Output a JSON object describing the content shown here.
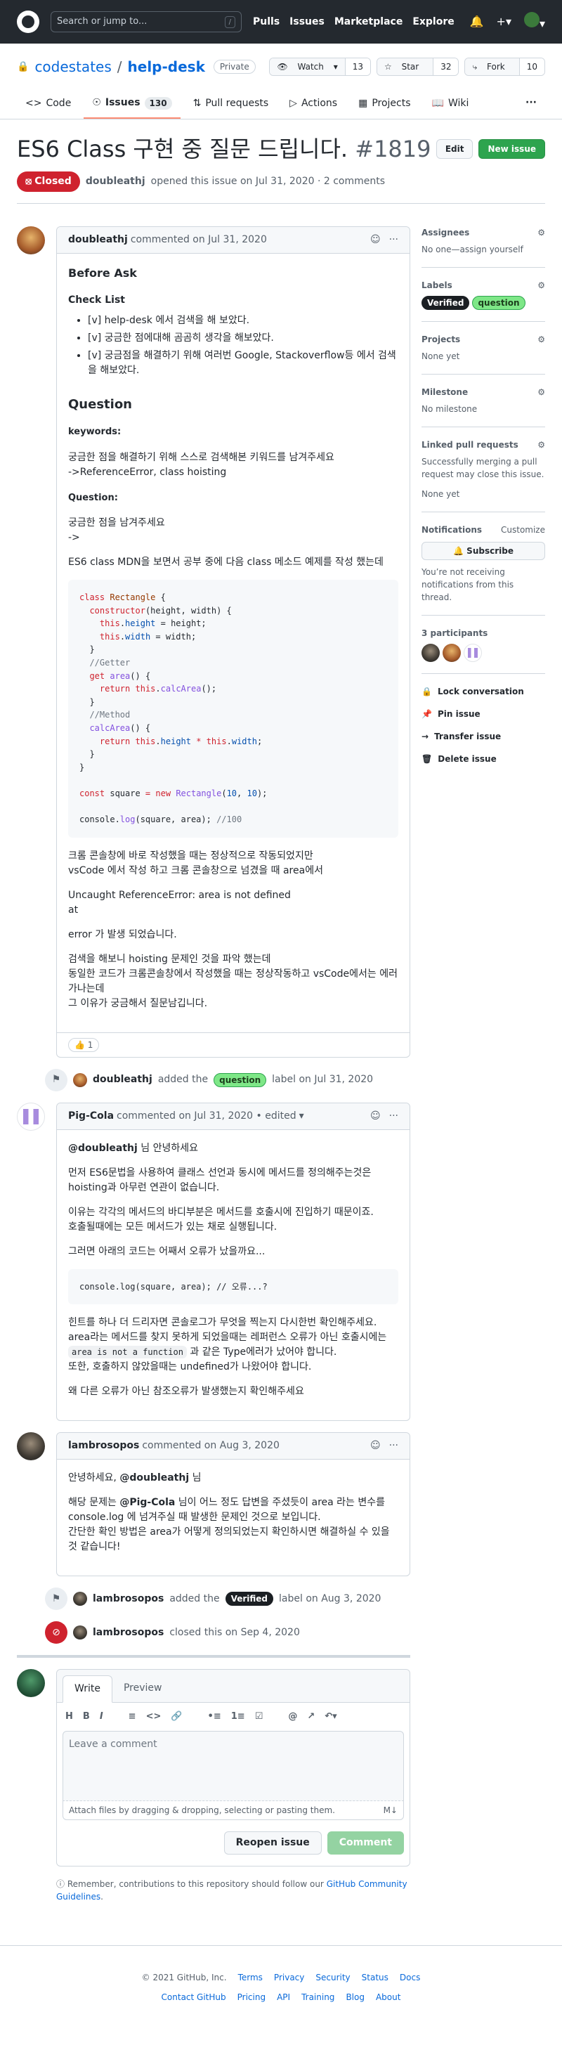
{
  "header": {
    "search_placeholder": "Search or jump to...",
    "search_shortcut": "/",
    "nav": [
      "Pulls",
      "Issues",
      "Marketplace",
      "Explore"
    ]
  },
  "repo": {
    "owner": "codestates",
    "name": "help-desk",
    "visibility": "Private",
    "watch_label": "Watch",
    "watch_count": "13",
    "star_label": "Star",
    "star_count": "32",
    "fork_label": "Fork",
    "fork_count": "10"
  },
  "tabs": [
    {
      "label": "Code"
    },
    {
      "label": "Issues",
      "count": "130"
    },
    {
      "label": "Pull requests"
    },
    {
      "label": "Actions"
    },
    {
      "label": "Projects"
    },
    {
      "label": "Wiki"
    }
  ],
  "issue": {
    "title": "ES6 Class 구현 중 질문 드립니다.",
    "number": "#1819",
    "edit_label": "Edit",
    "new_issue_label": "New issue",
    "state": "Closed",
    "author": "doubleathj",
    "meta_text": "opened this issue on Jul 31, 2020 · 2 comments"
  },
  "first_comment": {
    "author": "doubleathj",
    "date": "commented on Jul 31, 2020",
    "h_before": "Before Ask",
    "h_checklist": "Check List",
    "checklist": [
      "[v] help-desk 에서 검색을 해 보았다.",
      "[v] 궁금한 점에대해 곰곰히 생각을 해보았다.",
      "[v] 궁금점을 해결하기 위해 여러번 Google, Stackoverflow등 에서 검색을 해보았다."
    ],
    "h_question": "Question",
    "h_keywords": "keywords:",
    "keywords_line1": "궁금한 점을 해결하기 위해 스스로 검색해본 키워드를 남겨주세요",
    "keywords_line2": "->ReferenceError, class hoisting",
    "h_question2": "Question:",
    "q_line1": "궁금한 점을 남겨주세요",
    "q_line2": "->",
    "q_line3": "ES6 class MDN을 보면서 공부 중에 다음 class 메소드 예제를 작성 했는데",
    "p1_line1": "크롬 콘솔창에 바로 작성했을 때는 정상적으로 작동되었지만",
    "p1_line2": "vsCode 에서 작성 하고 크롬 콘솔창으로 넘겼을 때 area에서",
    "p2_line1": "Uncaught ReferenceError: area is not defined",
    "p2_line2": "at",
    "p3": "error 가 발생 되었습니다.",
    "p4_line1": "검색을 해보니 hoisting 문제인 것을 파악 했는데",
    "p4_line2": "동일한 코드가 크롬콘솔창에서 작성했을 때는 정상작동하고 vsCode에서는 에러가나는데",
    "p4_line3": "그 이유가 궁금해서 질문남깁니다.",
    "reaction": "👍 1"
  },
  "event_label_question": {
    "actor": "doubleathj",
    "action": "added the",
    "label": "question",
    "suffix": "label on Jul 31, 2020"
  },
  "second_comment": {
    "author": "Pig-Cola",
    "date": "commented on Jul 31, 2020 • edited",
    "mention": "@doubleathj",
    "greet": "님 안녕하세요",
    "p1_line1": "먼저 ES6문법을 사용하여 클래스 선언과 동시에 메서드를 정의해주는것은",
    "p1_line2": "hoisting과 아무런 연관이 없습니다.",
    "p2_line1": "이유는 각각의 메서드의 바디부분은 메서드를 호출시에 진입하기 때문이죠.",
    "p2_line2": "호출될때에는 모든 메서드가 있는 채로 실행됩니다.",
    "p3": "그러면 아래의 코드는 어째서 오류가 났을까요...",
    "code": "console.log(square, area); // 오류...?",
    "p4_line1": "힌트를 하나 더 드리자면 콘솔로그가 무엇을 찍는지 다시한번 확인해주세요.",
    "p4_line2a": "area라는 메서드를 찾지 못하게 되었을때는 레퍼런스 오류가 아닌 호출시에는",
    "p4_code": "area is not a function",
    "p4_line2b": "과 같은 Type에러가 났어야 합니다.",
    "p4_line3": "또한, 호출하지 않았을때는 undefined가 나왔어야 합니다.",
    "p5": "왜 다른 오류가 아닌 참조오류가 발생했는지 확인해주세요"
  },
  "third_comment": {
    "author": "lambrosopos",
    "date": "commented on Aug 3, 2020",
    "greet_a": "안녕하세요,",
    "greet_mention": "@doubleathj",
    "greet_b": "님",
    "p_line1a": "해당 문제는",
    "p_mention": "@Pig-Cola",
    "p_line1b": "님이 어느 정도 답변을 주셨듯이 area 라는 변수를",
    "p_line2": "console.log 에 넘겨주실 때 발생한 문제인 것으로 보입니다.",
    "p_line3": "간단한 확인 방법은 area가 어떻게 정의되었는지 확인하시면 해결하실 수 있을 것 같습니다!"
  },
  "event_label_verified": {
    "actor": "lambrosopos",
    "action": "added the",
    "label": "Verified",
    "suffix": "label on Aug 3, 2020"
  },
  "event_closed": {
    "actor": "lambrosopos",
    "suffix": "closed this on Sep 4, 2020"
  },
  "form": {
    "tab_write": "Write",
    "tab_preview": "Preview",
    "placeholder": "Leave a comment",
    "attach_text": "Attach files by dragging & dropping, selecting or pasting them.",
    "reopen_label": "Reopen issue",
    "comment_label": "Comment",
    "tip_text": "Remember, contributions to this repository should follow our",
    "tip_link": "GitHub Community Guidelines",
    "tip_end": "."
  },
  "sidebar": {
    "assignees_title": "Assignees",
    "assignees_value": "No one—assign yourself",
    "labels_title": "Labels",
    "labels": [
      "Verified",
      "question"
    ],
    "projects_title": "Projects",
    "projects_value": "None yet",
    "milestone_title": "Milestone",
    "milestone_value": "No milestone",
    "linked_title": "Linked pull requests",
    "linked_desc": "Successfully merging a pull request may close this issue.",
    "linked_value": "None yet",
    "notif_title": "Notifications",
    "notif_customize": "Customize",
    "subscribe_label": "Subscribe",
    "notif_desc": "You’re not receiving notifications from this thread.",
    "participants": "3 participants",
    "lock": "Lock conversation",
    "pin": "Pin issue",
    "transfer": "Transfer issue",
    "delete": "Delete issue"
  },
  "footer": {
    "copyright": "© 2021 GitHub, Inc.",
    "row1": [
      "Terms",
      "Privacy",
      "Security",
      "Status",
      "Docs"
    ],
    "row2": [
      "Contact GitHub",
      "Pricing",
      "API",
      "Training",
      "Blog",
      "About"
    ]
  }
}
